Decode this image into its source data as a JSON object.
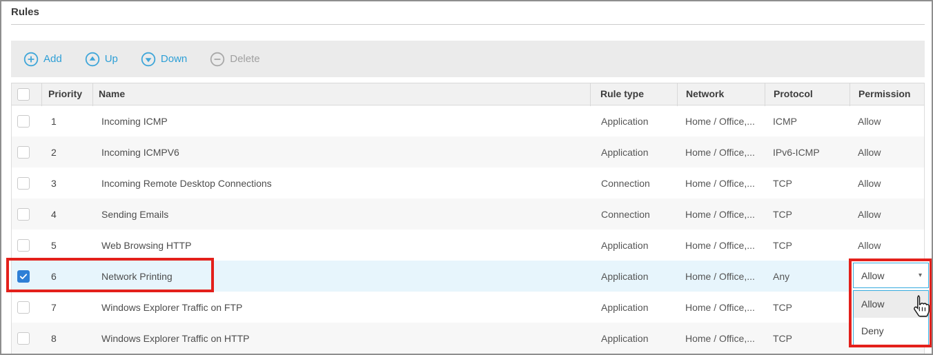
{
  "page": {
    "title": "Rules"
  },
  "toolbar": {
    "buttons": [
      {
        "label": "Add",
        "icon": "plus-circle-icon",
        "enabled": true
      },
      {
        "label": "Up",
        "icon": "arrow-up-circle-icon",
        "enabled": true
      },
      {
        "label": "Down",
        "icon": "arrow-down-circle-icon",
        "enabled": true
      },
      {
        "label": "Delete",
        "icon": "minus-circle-icon",
        "enabled": false
      }
    ]
  },
  "table": {
    "headers": {
      "priority": "Priority",
      "name": "Name",
      "rule_type": "Rule type",
      "network": "Network",
      "protocol": "Protocol",
      "permission": "Permission"
    },
    "rows": [
      {
        "priority": "1",
        "name": "Incoming ICMP",
        "rule_type": "Application",
        "network": "Home / Office,...",
        "protocol": "ICMP",
        "permission": "Allow",
        "checked": false,
        "selected": false
      },
      {
        "priority": "2",
        "name": "Incoming ICMPV6",
        "rule_type": "Application",
        "network": "Home / Office,...",
        "protocol": "IPv6-ICMP",
        "permission": "Allow",
        "checked": false,
        "selected": false
      },
      {
        "priority": "3",
        "name": "Incoming Remote Desktop Connections",
        "rule_type": "Connection",
        "network": "Home / Office,...",
        "protocol": "TCP",
        "permission": "Allow",
        "checked": false,
        "selected": false
      },
      {
        "priority": "4",
        "name": "Sending Emails",
        "rule_type": "Connection",
        "network": "Home / Office,...",
        "protocol": "TCP",
        "permission": "Allow",
        "checked": false,
        "selected": false
      },
      {
        "priority": "5",
        "name": "Web Browsing HTTP",
        "rule_type": "Application",
        "network": "Home / Office,...",
        "protocol": "TCP",
        "permission": "Allow",
        "checked": false,
        "selected": false
      },
      {
        "priority": "6",
        "name": "Network Printing",
        "rule_type": "Application",
        "network": "Home / Office,...",
        "protocol": "Any",
        "permission": "",
        "checked": true,
        "selected": true
      },
      {
        "priority": "7",
        "name": "Windows Explorer Traffic on FTP",
        "rule_type": "Application",
        "network": "Home / Office,...",
        "protocol": "TCP",
        "permission": "",
        "checked": false,
        "selected": false
      },
      {
        "priority": "8",
        "name": "Windows Explorer Traffic on HTTP",
        "rule_type": "Application",
        "network": "Home / Office,...",
        "protocol": "TCP",
        "permission": "",
        "checked": false,
        "selected": false
      }
    ]
  },
  "permission_dropdown": {
    "value": "Allow",
    "options": [
      "Allow",
      "Deny"
    ],
    "hovered_option": "Allow"
  },
  "colors": {
    "accent_blue": "#30a3dc",
    "selected_row_bg": "#e7f5fc",
    "checkbox_checked": "#2e7fd6",
    "annotation_red": "#e3201b",
    "dropdown_border": "#35aade"
  }
}
